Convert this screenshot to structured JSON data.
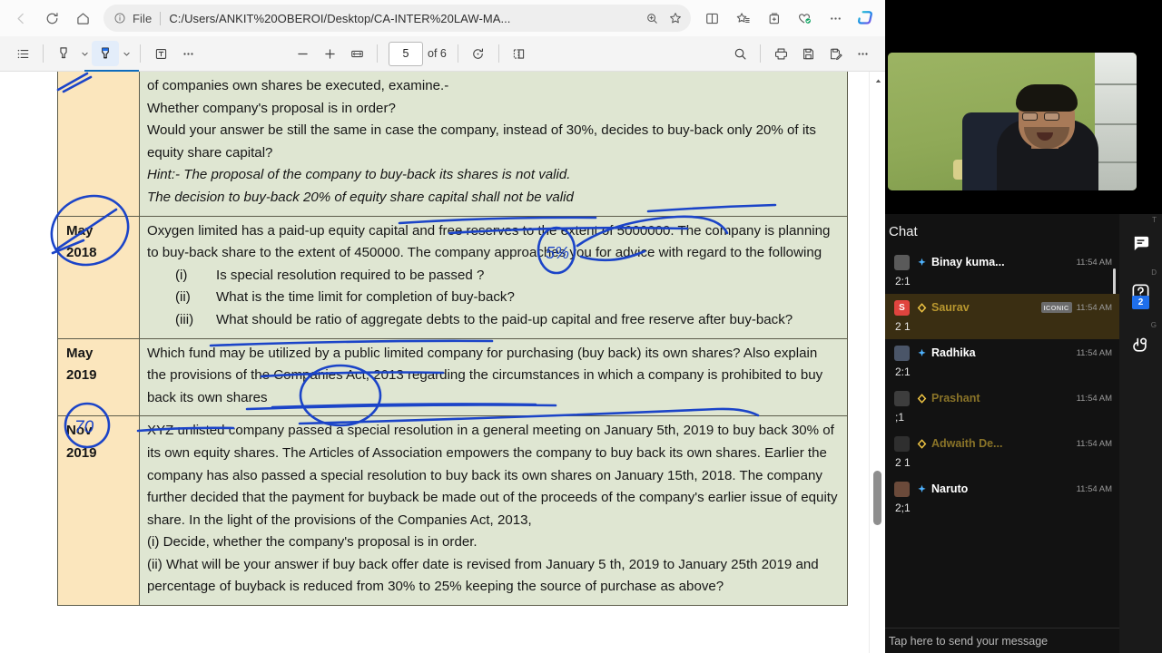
{
  "browser": {
    "nav": {
      "back_icon": "arrow-left-icon",
      "refresh_icon": "refresh-icon",
      "home_icon": "home-icon",
      "info_icon": "info-circle-icon",
      "file_label": "File",
      "url": "C:/Users/ANKIT%20OBEROI/Desktop/CA-INTER%20LAW-MA...",
      "zoom_icon": "zoom-in-icon",
      "favorite_icon": "star-icon",
      "split_screen_icon": "split-screen-icon",
      "favorites_list_icon": "favorites-list-icon",
      "collections_icon": "collections-add-icon",
      "browser_essentials_icon": "browser-essentials-icon",
      "more_icon": "more-horizontal-icon",
      "copilot_icon": "copilot-icon"
    }
  },
  "pdf_toolbar": {
    "toc_icon": "table-of-contents-icon",
    "highlight_icon": "highlighter-icon",
    "highlight_caret_icon": "chevron-down-icon",
    "draw_icon": "draw-pen-icon",
    "draw_caret_icon": "chevron-down-icon",
    "text_icon": "add-text-icon",
    "more_tools_icon": "more-horizontal-icon",
    "zoom_out_icon": "minus-icon",
    "zoom_in_icon": "plus-icon",
    "fit_page_icon": "fit-to-width-icon",
    "current_page": "5",
    "page_total_label": "of 6",
    "rotate_icon": "rotate-icon",
    "page_view_icon": "page-view-icon",
    "search_icon": "search-icon",
    "print_icon": "print-icon",
    "save_icon": "save-icon",
    "save_as_icon": "save-as-icon",
    "more_icon": "more-horizontal-icon"
  },
  "document": {
    "rows": [
      {
        "date": "",
        "partial": true,
        "paragraphs": [
          "of companies own shares be executed, examine.-",
          "Whether company's proposal is in order?",
          "Would your answer be still the same in case the company, instead of 30%, decides to buy-back only 20% of its equity share capital?"
        ],
        "hints": [
          "Hint:- The proposal of the company to buy-back its shares is not valid.",
          "The decision to buy-back 20% of equity share capital shall not be valid"
        ],
        "items": []
      },
      {
        "date_line1": "May",
        "date_line2": "2018",
        "partial": false,
        "paragraphs": [
          "Oxygen limited has a paid-up equity capital and free reserves to the extent of 5000000. The company is planning to buy-back share to the extent of 450000. The company approaches you for advice with regard to the following"
        ],
        "hints": [],
        "items": [
          {
            "num": "(i)",
            "text": "Is special resolution required to be passed ?"
          },
          {
            "num": "(ii)",
            "text": "What is the time limit for completion of buy-back?"
          },
          {
            "num": "(iii)",
            "text": "What should be ratio of aggregate debts to the paid-up capital and free reserve after buy-back?"
          }
        ]
      },
      {
        "date_line1": "May",
        "date_line2": "2019",
        "partial": false,
        "paragraphs": [
          "Which fund may be utilized by a public limited company for purchasing (buy back) its own shares? Also explain the provisions of the Companies Act, 2013 regarding  the  circumstances in which a company is prohibited to buy back its own shares"
        ],
        "hints": [],
        "items": []
      },
      {
        "date_line1": "Nov",
        "date_line2": "2019",
        "partial": false,
        "paragraphs": [
          "XYZ unlisted company passed a special resolution in a general meeting on January 5th, 2019 to buy back 30% of its own equity shares. The Articles of Association empowers the company to buy back its own shares. Earlier the company has also passed a special  resolution to buy back its own shares on January 15th, 2018.  The  company  further decided that the payment for buyback be made out of the proceeds of the company's  earlier issue of equity share. In the light of the provisions of the Companies Act, 2013,",
          "(i) Decide, whether the company's proposal is in order.",
          "(ii) What will be your answer if buy back offer date is revised from January 5 th, 2019 to January 25th 2019 and percentage of buyback is reduced from 30% to 25% keeping the source of purchase as above?"
        ],
        "hints": [],
        "items": []
      }
    ],
    "annotations": {
      "ink_color": "#1b44c8",
      "circled_note_2018": "5%",
      "circled_note_2019": "70"
    }
  },
  "meeting": {
    "video_caption": "",
    "chat_title": "Chat",
    "messages": [
      {
        "name": "Binay kuma...",
        "time": "11:54 AM",
        "text": "2:1",
        "avatar_initial": "",
        "avatar_color": "#5a5a5a",
        "badge": "sparkle-icon",
        "badge_color": "#4fb3ff",
        "name_color": "#ffffff",
        "tag": "",
        "highlight": false
      },
      {
        "name": "Saurav",
        "time": "11:54 AM",
        "text": "2 1",
        "avatar_initial": "S",
        "avatar_color": "#e0443e",
        "badge": "diamond-icon",
        "badge_color": "#f2c744",
        "name_color": "#b8972f",
        "tag": "ICONIC",
        "highlight": true
      },
      {
        "name": "Radhika",
        "time": "11:54 AM",
        "text": "2:1",
        "avatar_initial": "",
        "avatar_color": "#4a5568",
        "badge": "sparkle-icon",
        "badge_color": "#4fb3ff",
        "name_color": "#ffffff",
        "tag": "",
        "highlight": false
      },
      {
        "name": "Prashant",
        "time": "11:54 AM",
        "text": ";1",
        "avatar_initial": "",
        "avatar_color": "#3d3d3d",
        "badge": "diamond-icon",
        "badge_color": "#f2c744",
        "name_color": "#8a7428",
        "tag": "",
        "highlight": false
      },
      {
        "name": "Adwaith De...",
        "time": "11:54 AM",
        "text": "2 1",
        "avatar_initial": "",
        "avatar_color": "#2f2f2f",
        "badge": "diamond-icon",
        "badge_color": "#f2c744",
        "name_color": "#8a7428",
        "tag": "",
        "highlight": false
      },
      {
        "name": "Naruto",
        "time": "11:54 AM",
        "text": "2;1",
        "avatar_initial": "",
        "avatar_color": "#6b4a3a",
        "badge": "sparkle-icon",
        "badge_color": "#4fb3ff",
        "name_color": "#ffffff",
        "tag": "",
        "highlight": false
      }
    ],
    "input_placeholder": "Tap here to send your message",
    "rail": {
      "chat_icon": "chat-bubble-icon",
      "chat_letter": "T",
      "doubt_icon": "question-mark-icon",
      "doubt_letter": "D",
      "doubt_badge": "2",
      "hand_icon": "raise-hand-icon",
      "hand_letter": "G"
    }
  }
}
